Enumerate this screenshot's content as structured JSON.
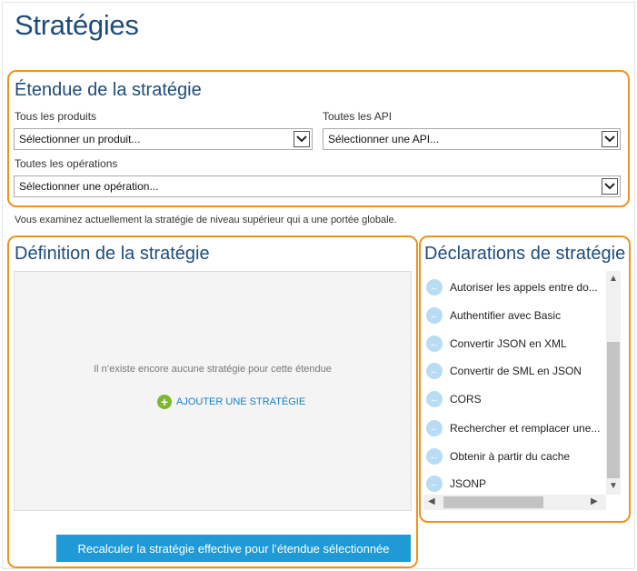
{
  "page": {
    "title": "Stratégies"
  },
  "scope": {
    "title": "Étendue de la stratégie",
    "products_label": "Tous les produits",
    "products_value": "Sélectionner un produit...",
    "apis_label": "Toutes les API",
    "apis_value": "Sélectionner une API...",
    "operations_label": "Toutes les opérations",
    "operations_value": "Sélectionner une opération..."
  },
  "note": "Vous examinez actuellement la stratégie de niveau supérieur qui a une portée globale.",
  "definition": {
    "title": "Définition de la stratégie",
    "empty_message": "Il n’existe encore aucune stratégie pour cette étendue",
    "add_label": "AJOUTER UNE STRATÉGIE",
    "recalc_label": "Recalculer la stratégie effective pour l’étendue sélectionnée"
  },
  "declarations": {
    "title": "Déclarations de stratégie",
    "items": [
      "Autoriser les appels entre do...",
      "Authentifier avec Basic",
      "Convertir JSON en XML",
      "Convertir de SML en JSON",
      "CORS",
      "Rechercher et remplacer une...",
      "Obtenir à partir du cache",
      "JSONP"
    ]
  },
  "colors": {
    "accent_orange": "#f0921e",
    "title_blue": "#1e4d7b",
    "button_blue": "#1f9ad6",
    "add_green": "#7cb82f"
  }
}
